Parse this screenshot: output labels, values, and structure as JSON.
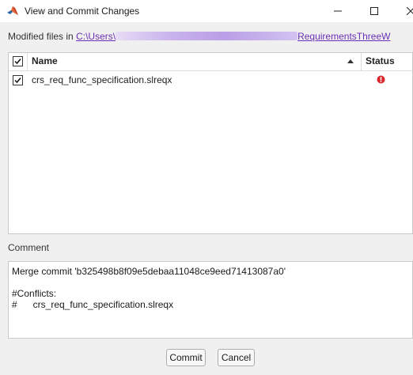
{
  "window": {
    "title": "View and Commit Changes",
    "controls": [
      "minimize",
      "maximize",
      "close"
    ]
  },
  "modified_files": {
    "label": "Modified files in",
    "path_start": "C:\\Users\\",
    "path_end": "RequirementsThreeW"
  },
  "file_list": {
    "columns": {
      "name": "Name",
      "status": "Status"
    },
    "sort_column": "Name",
    "header_checked": true,
    "rows": [
      {
        "checked": true,
        "name": "crs_req_func_specification.slreqx",
        "status_icon": "conflict-error-icon",
        "status_color": "#d9262b"
      }
    ]
  },
  "comment": {
    "label": "Comment",
    "text": "Merge commit 'b325498b8f09e5debaa11048ce9eed71413087a0'\n\n#Conflicts:\n#\tcrs_req_func_specification.slreqx"
  },
  "buttons": {
    "commit": "Commit",
    "cancel": "Cancel"
  }
}
